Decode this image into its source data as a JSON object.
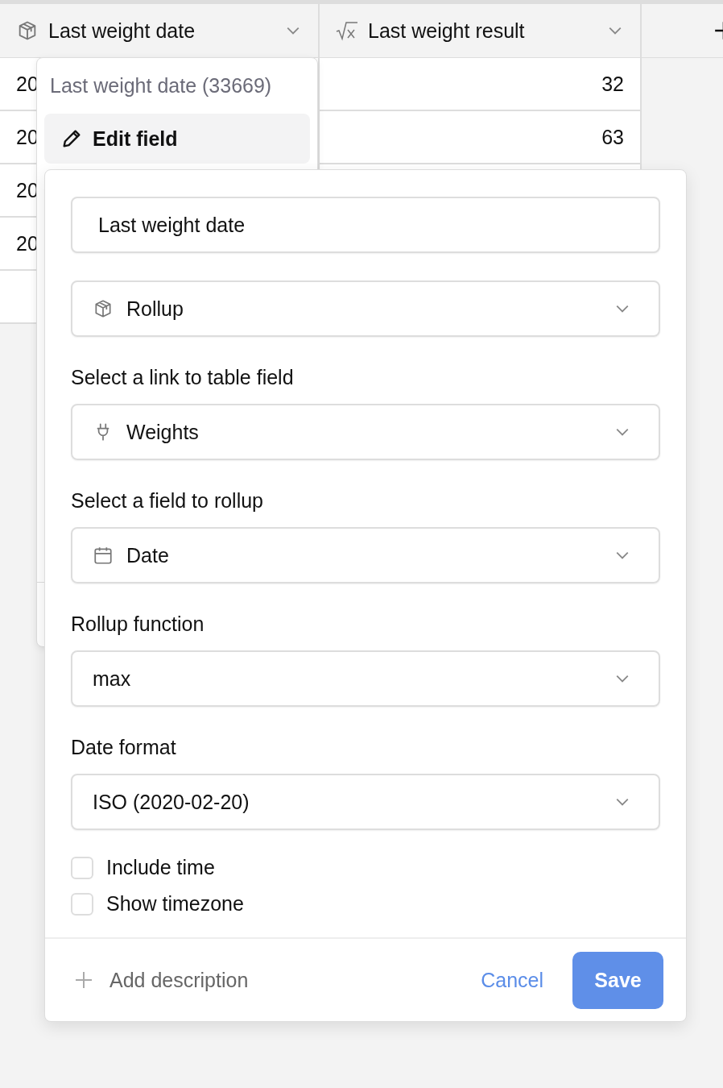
{
  "table": {
    "columns": [
      {
        "label": "Last weight date"
      },
      {
        "label": "Last weight result"
      }
    ],
    "rows": [
      {
        "column_1": "20",
        "column_2": "32"
      },
      {
        "column_1": "20",
        "column_2": "63"
      },
      {
        "column_1": "20"
      },
      {
        "column_1": "20"
      },
      {}
    ]
  },
  "field_menu": {
    "title": "Last weight date (33669)",
    "items": [
      {
        "label": "Edit field",
        "selected": true
      }
    ]
  },
  "edit_form": {
    "fields": [
      {
        "kind": "input",
        "value": "Last weight date"
      },
      {
        "kind": "type",
        "value": "Rollup"
      },
      {
        "kind": "link",
        "label": "Select a link to table field",
        "value": "Weights"
      },
      {
        "kind": "date",
        "label": "Select a field to rollup",
        "value": "Date"
      },
      {
        "kind": "select",
        "label": "Rollup function",
        "value": "max"
      },
      {
        "kind": "select",
        "label": "Date format",
        "value": "ISO (2020-02-20)"
      }
    ],
    "checkboxes": [
      {
        "label": "Include time",
        "checked": false
      },
      {
        "label": "Show timezone",
        "checked": false
      }
    ],
    "add_description": "Add description",
    "cancel": "Cancel",
    "save": "Save"
  }
}
